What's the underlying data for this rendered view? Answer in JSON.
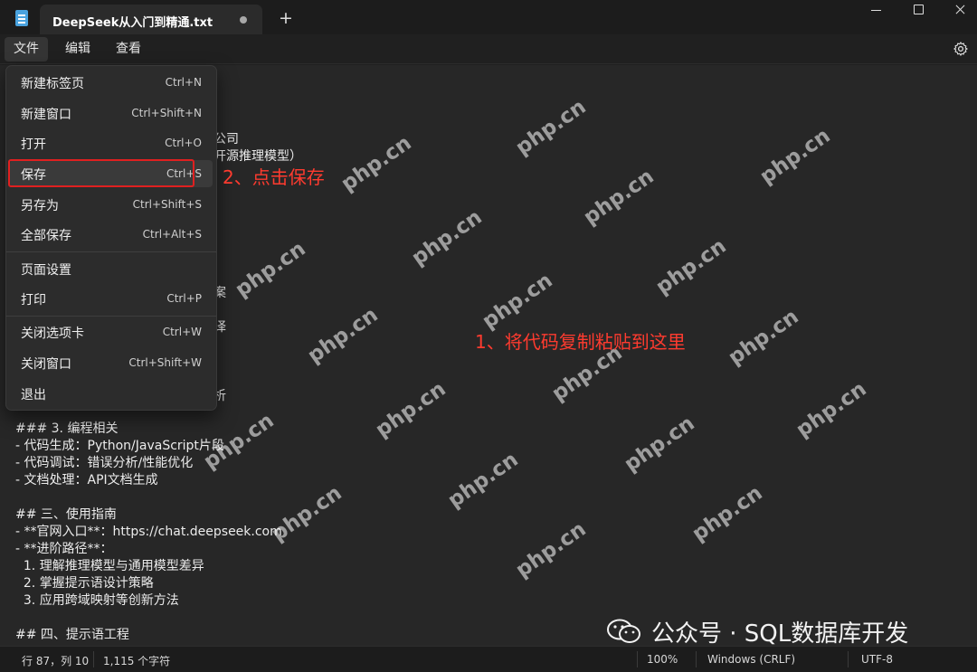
{
  "titlebar": {
    "tab_title": "DeepSeek从入门到精通.txt",
    "new_tab": "+"
  },
  "menubar": {
    "items": [
      "文件",
      "编辑",
      "查看"
    ]
  },
  "dropdown": {
    "items": [
      {
        "label": "新建标签页",
        "shortcut": "Ctrl+N"
      },
      {
        "label": "新建窗口",
        "shortcut": "Ctrl+Shift+N"
      },
      {
        "label": "打开",
        "shortcut": "Ctrl+O"
      },
      {
        "label": "保存",
        "shortcut": "Ctrl+S"
      },
      {
        "label": "另存为",
        "shortcut": "Ctrl+Shift+S"
      },
      {
        "label": "全部保存",
        "shortcut": "Ctrl+Alt+S"
      },
      {
        "label": "页面设置",
        "shortcut": ""
      },
      {
        "label": "打印",
        "shortcut": "Ctrl+P"
      },
      {
        "label": "关闭选项卡",
        "shortcut": "Ctrl+W"
      },
      {
        "label": "关闭窗口",
        "shortcut": "Ctrl+Shift+W"
      },
      {
        "label": "退出",
        "shortcut": ""
      }
    ]
  },
  "editor": {
    "partial_lines": [
      "公司",
      "开源推理模型）",
      "案",
      "译",
      "析"
    ],
    "lines": [
      "### 3. 编程相关",
      "- 代码生成：Python/JavaScript片段",
      "- 代码调试：错误分析/性能优化",
      "- 文档处理：API文档生成",
      "",
      "## 三、使用指南",
      "- **官网入口**：https://chat.deepseek.com",
      "- **进阶路径**：",
      "  1. 理解推理模型与通用模型差异",
      "  2. 掌握提示语设计策略",
      "  3. 应用跨域映射等创新方法",
      "",
      "## 四、提示语工程"
    ]
  },
  "annotations": {
    "step1": "1、将代码复制粘贴到这里",
    "step2": "2、点击保存"
  },
  "watermark": {
    "text": "php.cn"
  },
  "statusbar": {
    "position": "行 87，列 10",
    "char_count": "1,115 个字符",
    "zoom": "100%",
    "line_ending": "Windows (CRLF)",
    "encoding": "UTF-8"
  },
  "brand": {
    "text": "公众号 · SQL数据库开发"
  },
  "colors": {
    "accent_red": "#e02020",
    "background": "#272727"
  }
}
